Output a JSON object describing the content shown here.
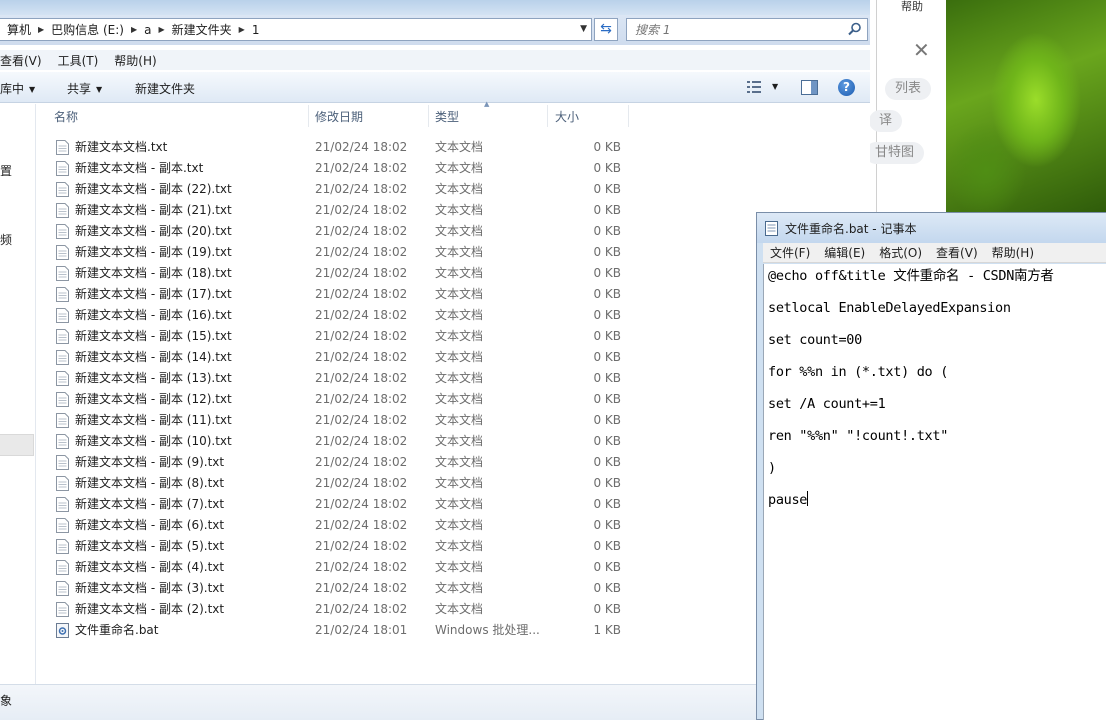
{
  "background_app": {
    "help_label": "帮助",
    "pills": [
      "列表",
      "译",
      "甘特图"
    ]
  },
  "explorer": {
    "breadcrumb": [
      "算机",
      "巴购信息 (E:)",
      "a",
      "新建文件夹",
      "1"
    ],
    "search_placeholder": "搜索 1",
    "menu": [
      "查看(V)",
      "工具(T)",
      "帮助(H)"
    ],
    "toolbar": {
      "library_label": "库中",
      "share_label": "共享",
      "new_folder_label": "新建文件夹"
    },
    "nav_fragments": [
      "置",
      "频"
    ],
    "columns": {
      "name": "名称",
      "date": "修改日期",
      "type": "类型",
      "size": "大小"
    },
    "files": [
      {
        "name": "新建文本文档.txt",
        "date": "21/02/24 18:02",
        "type": "文本文档",
        "size": "0 KB",
        "kind": "txt"
      },
      {
        "name": "新建文本文档 - 副本.txt",
        "date": "21/02/24 18:02",
        "type": "文本文档",
        "size": "0 KB",
        "kind": "txt"
      },
      {
        "name": "新建文本文档 - 副本 (22).txt",
        "date": "21/02/24 18:02",
        "type": "文本文档",
        "size": "0 KB",
        "kind": "txt"
      },
      {
        "name": "新建文本文档 - 副本 (21).txt",
        "date": "21/02/24 18:02",
        "type": "文本文档",
        "size": "0 KB",
        "kind": "txt"
      },
      {
        "name": "新建文本文档 - 副本 (20).txt",
        "date": "21/02/24 18:02",
        "type": "文本文档",
        "size": "0 KB",
        "kind": "txt"
      },
      {
        "name": "新建文本文档 - 副本 (19).txt",
        "date": "21/02/24 18:02",
        "type": "文本文档",
        "size": "0 KB",
        "kind": "txt"
      },
      {
        "name": "新建文本文档 - 副本 (18).txt",
        "date": "21/02/24 18:02",
        "type": "文本文档",
        "size": "0 KB",
        "kind": "txt"
      },
      {
        "name": "新建文本文档 - 副本 (17).txt",
        "date": "21/02/24 18:02",
        "type": "文本文档",
        "size": "0 KB",
        "kind": "txt"
      },
      {
        "name": "新建文本文档 - 副本 (16).txt",
        "date": "21/02/24 18:02",
        "type": "文本文档",
        "size": "0 KB",
        "kind": "txt"
      },
      {
        "name": "新建文本文档 - 副本 (15).txt",
        "date": "21/02/24 18:02",
        "type": "文本文档",
        "size": "0 KB",
        "kind": "txt"
      },
      {
        "name": "新建文本文档 - 副本 (14).txt",
        "date": "21/02/24 18:02",
        "type": "文本文档",
        "size": "0 KB",
        "kind": "txt"
      },
      {
        "name": "新建文本文档 - 副本 (13).txt",
        "date": "21/02/24 18:02",
        "type": "文本文档",
        "size": "0 KB",
        "kind": "txt"
      },
      {
        "name": "新建文本文档 - 副本 (12).txt",
        "date": "21/02/24 18:02",
        "type": "文本文档",
        "size": "0 KB",
        "kind": "txt"
      },
      {
        "name": "新建文本文档 - 副本 (11).txt",
        "date": "21/02/24 18:02",
        "type": "文本文档",
        "size": "0 KB",
        "kind": "txt"
      },
      {
        "name": "新建文本文档 - 副本 (10).txt",
        "date": "21/02/24 18:02",
        "type": "文本文档",
        "size": "0 KB",
        "kind": "txt"
      },
      {
        "name": "新建文本文档 - 副本 (9).txt",
        "date": "21/02/24 18:02",
        "type": "文本文档",
        "size": "0 KB",
        "kind": "txt"
      },
      {
        "name": "新建文本文档 - 副本 (8).txt",
        "date": "21/02/24 18:02",
        "type": "文本文档",
        "size": "0 KB",
        "kind": "txt"
      },
      {
        "name": "新建文本文档 - 副本 (7).txt",
        "date": "21/02/24 18:02",
        "type": "文本文档",
        "size": "0 KB",
        "kind": "txt"
      },
      {
        "name": "新建文本文档 - 副本 (6).txt",
        "date": "21/02/24 18:02",
        "type": "文本文档",
        "size": "0 KB",
        "kind": "txt"
      },
      {
        "name": "新建文本文档 - 副本 (5).txt",
        "date": "21/02/24 18:02",
        "type": "文本文档",
        "size": "0 KB",
        "kind": "txt"
      },
      {
        "name": "新建文本文档 - 副本 (4).txt",
        "date": "21/02/24 18:02",
        "type": "文本文档",
        "size": "0 KB",
        "kind": "txt"
      },
      {
        "name": "新建文本文档 - 副本 (3).txt",
        "date": "21/02/24 18:02",
        "type": "文本文档",
        "size": "0 KB",
        "kind": "txt"
      },
      {
        "name": "新建文本文档 - 副本 (2).txt",
        "date": "21/02/24 18:02",
        "type": "文本文档",
        "size": "0 KB",
        "kind": "txt"
      },
      {
        "name": "文件重命名.bat",
        "date": "21/02/24 18:01",
        "type": "Windows 批处理...",
        "size": "1 KB",
        "kind": "bat"
      }
    ],
    "status_text": "象"
  },
  "notepad": {
    "title": "文件重命名.bat - 记事本",
    "menu": [
      "文件(F)",
      "编辑(E)",
      "格式(O)",
      "查看(V)",
      "帮助(H)"
    ],
    "lines": [
      "@echo off&title 文件重命名 - CSDN南方者",
      "setlocal EnableDelayedExpansion",
      "set count=00",
      "for %%n in (*.txt) do (",
      "set /A count+=1",
      "ren \"%%n\" \"!count!.txt\"",
      ")",
      "pause"
    ]
  }
}
